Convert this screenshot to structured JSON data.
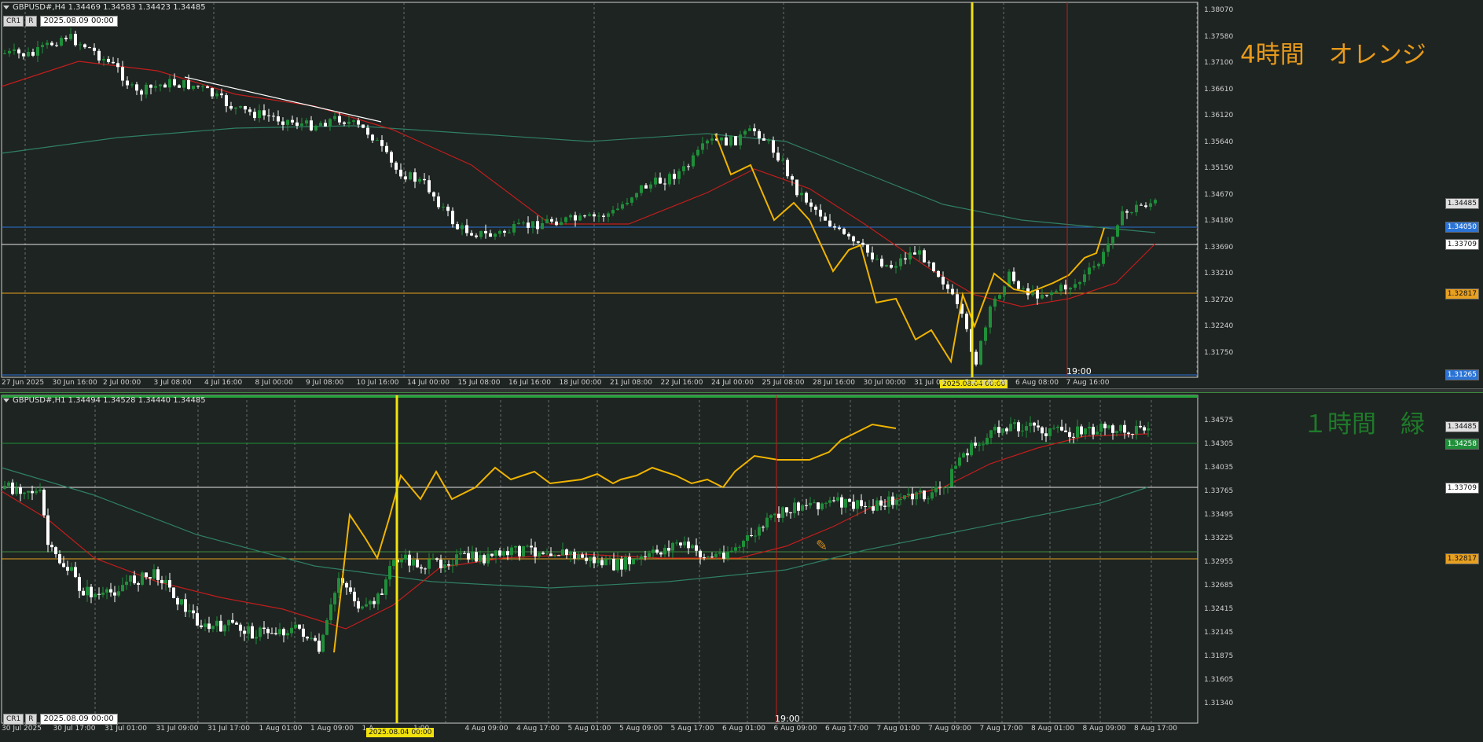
{
  "h4": {
    "info": "GBPUSD#,H4  1.34469 1.34583 1.34423 1.34485",
    "btn_cr": "CR1",
    "btn_r": "R",
    "date_box": "2025.08.09 00:00",
    "label": "4時間　オレンジ",
    "label_color": "#e89a1a",
    "time_marker": "19:00",
    "price_axis": [
      "1.38070",
      "1.37580",
      "1.37100",
      "1.36610",
      "1.36120",
      "1.35640",
      "1.35150",
      "1.34670",
      "1.34180",
      "1.33690",
      "1.33210",
      "1.32720",
      "1.32240",
      "1.31750"
    ],
    "price_tags": {
      "current": "1.34485",
      "blue": "1.34050",
      "white": "1.33709",
      "orange": "1.32817",
      "bottom": "1.31265"
    },
    "dates": [
      "27 Jun 2025",
      "30 Jun 16:00",
      "2 Jul 00:00",
      "3 Jul 08:00",
      "4 Jul 16:00",
      "8 Jul 00:00",
      "9 Jul 08:00",
      "10 Jul 16:00",
      "14 Jul 00:00",
      "15 Jul 08:00",
      "16 Jul 16:00",
      "18 Jul 00:00",
      "21 Jul 08:00",
      "22 Jul 16:00",
      "24 Jul 00:00",
      "25 Jul 08:00",
      "28 Jul 16:00",
      "30 Jul 00:00",
      "31 Jul 08:",
      "5 Aug 00:00",
      "6 Aug 08:00",
      "7 Aug 16:00"
    ],
    "highlight_date": "2025.08.04 00:00"
  },
  "h1": {
    "info": "GBPUSD#,H1  1.34494 1.34528 1.34440 1.34485",
    "btn_cr": "CR1",
    "btn_r": "R",
    "date_box": "2025.08.09 00:00",
    "label": "１時間　緑",
    "label_color": "#1e7a2a",
    "time_marker": "19:00",
    "price_axis": [
      "1.34575",
      "1.34305",
      "1.34035",
      "1.33765",
      "1.33495",
      "1.33225",
      "1.32955",
      "1.32685",
      "1.32415",
      "1.32145",
      "1.31875",
      "1.31605",
      "1.31340"
    ],
    "price_tags": {
      "current": "1.34485",
      "green": "1.34258",
      "white": "1.33709",
      "orange": "1.32817"
    },
    "dates": [
      "30 Jul 2025",
      "30 Jul 17:00",
      "31 Jul 01:00",
      "31 Jul 09:00",
      "31 Jul 17:00",
      "1 Aug 01:00",
      "1 Aug 09:00",
      "1 A",
      "1:00",
      "4 Aug 09:00",
      "4 Aug 17:00",
      "5 Aug 01:00",
      "5 Aug 09:00",
      "5 Aug 17:00",
      "6 Aug 01:00",
      "6 Aug 09:00",
      "6 Aug 17:00",
      "7 Aug 01:00",
      "7 Aug 09:00",
      "7 Aug 17:00",
      "8 Aug 01:00",
      "8 Aug 09:00",
      "8 Aug 17:00"
    ],
    "highlight_date": "2025.08.04 00:00"
  },
  "colors": {
    "bg": "#1e2421",
    "bull": "#1f8f3a",
    "bear": "#ffffff",
    "ma_short": "#c21d1d",
    "ma_long": "#2f7f66",
    "zigzag": "#f0b400",
    "vline_yellow": "#f2e20c",
    "vline_red": "#c21d1d",
    "hline_blue": "#2b74d6",
    "hline_white": "#e6e6e6",
    "hline_orange": "#e8a020",
    "hline_green": "#1f8f3a"
  }
}
